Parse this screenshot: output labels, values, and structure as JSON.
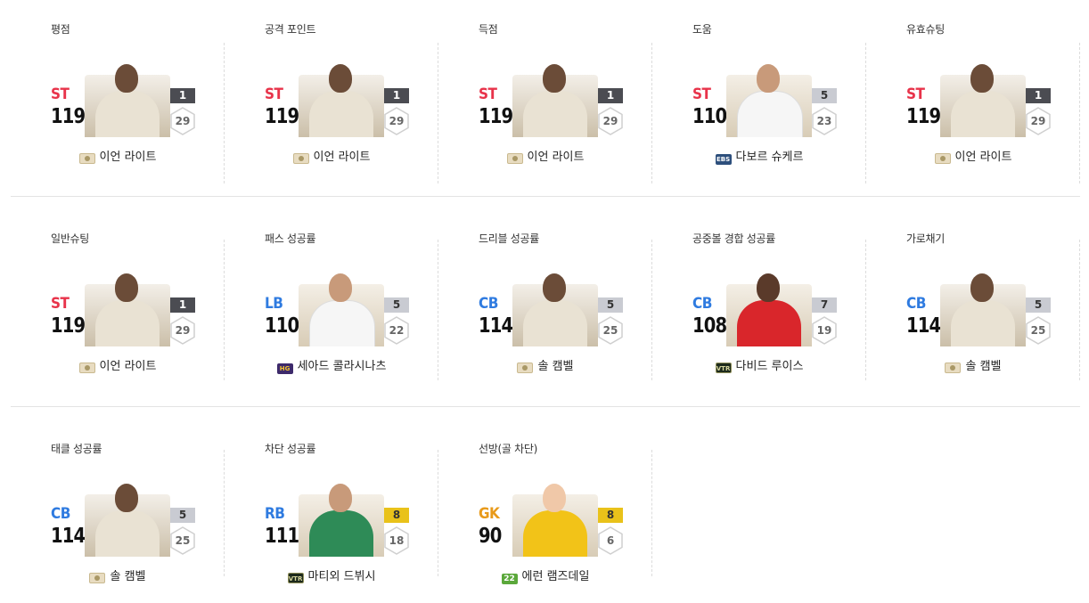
{
  "rows": [
    [
      {
        "title": "평점",
        "position": "ST",
        "pos_class": "fw",
        "ovr": "119",
        "rank": "1",
        "rank_tier": "dark",
        "level": "29",
        "season": "icon",
        "season_label": "",
        "name": "이언 라이트",
        "kit": "icon"
      },
      {
        "title": "공격 포인트",
        "position": "ST",
        "pos_class": "fw",
        "ovr": "119",
        "rank": "1",
        "rank_tier": "dark",
        "level": "29",
        "season": "icon",
        "season_label": "",
        "name": "이언 라이트",
        "kit": "icon"
      },
      {
        "title": "득점",
        "position": "ST",
        "pos_class": "fw",
        "ovr": "119",
        "rank": "1",
        "rank_tier": "dark",
        "level": "29",
        "season": "icon",
        "season_label": "",
        "name": "이언 라이트",
        "kit": "icon"
      },
      {
        "title": "도움",
        "position": "ST",
        "pos_class": "fw",
        "ovr": "110",
        "rank": "5",
        "rank_tier": "silver",
        "level": "23",
        "season": "ebs",
        "season_label": "EBS",
        "name": "다보르 슈케르",
        "kit": "c-white"
      },
      {
        "title": "유효슈팅",
        "position": "ST",
        "pos_class": "fw",
        "ovr": "119",
        "rank": "1",
        "rank_tier": "dark",
        "level": "29",
        "season": "icon",
        "season_label": "",
        "name": "이언 라이트",
        "kit": "icon"
      }
    ],
    [
      {
        "title": "일반슈팅",
        "position": "ST",
        "pos_class": "fw",
        "ovr": "119",
        "rank": "1",
        "rank_tier": "dark",
        "level": "29",
        "season": "icon",
        "season_label": "",
        "name": "이언 라이트",
        "kit": "icon"
      },
      {
        "title": "패스 성공률",
        "position": "LB",
        "pos_class": "df",
        "ovr": "110",
        "rank": "5",
        "rank_tier": "silver",
        "level": "22",
        "season": "hg",
        "season_label": "HG",
        "name": "세아드 콜라시나츠",
        "kit": "c-white"
      },
      {
        "title": "드리블 성공률",
        "position": "CB",
        "pos_class": "df",
        "ovr": "114",
        "rank": "5",
        "rank_tier": "silver",
        "level": "25",
        "season": "icon",
        "season_label": "",
        "name": "솔 캠벨",
        "kit": "icon"
      },
      {
        "title": "공중볼 경합 성공률",
        "position": "CB",
        "pos_class": "df",
        "ovr": "108",
        "rank": "7",
        "rank_tier": "silver",
        "level": "19",
        "season": "vtr",
        "season_label": "VTR",
        "name": "다비드 루이스",
        "kit": "c-red"
      },
      {
        "title": "가로채기",
        "position": "CB",
        "pos_class": "df",
        "ovr": "114",
        "rank": "5",
        "rank_tier": "silver",
        "level": "25",
        "season": "icon",
        "season_label": "",
        "name": "솔 캠벨",
        "kit": "icon"
      }
    ],
    [
      {
        "title": "태클 성공률",
        "position": "CB",
        "pos_class": "df",
        "ovr": "114",
        "rank": "5",
        "rank_tier": "silver",
        "level": "25",
        "season": "icon",
        "season_label": "",
        "name": "솔 캠벨",
        "kit": "icon"
      },
      {
        "title": "차단 성공률",
        "position": "RB",
        "pos_class": "df",
        "ovr": "111",
        "rank": "8",
        "rank_tier": "gold",
        "level": "18",
        "season": "vtr",
        "season_label": "VTR",
        "name": "마티외 드뷔시",
        "kit": "c-green"
      },
      {
        "title": "선방(골 차단)",
        "position": "GK",
        "pos_class": "gk",
        "ovr": "90",
        "rank": "8",
        "rank_tier": "gold",
        "level": "6",
        "season": "s22",
        "season_label": "22",
        "name": "에런 램즈데일",
        "kit": "c-yellow"
      }
    ]
  ]
}
